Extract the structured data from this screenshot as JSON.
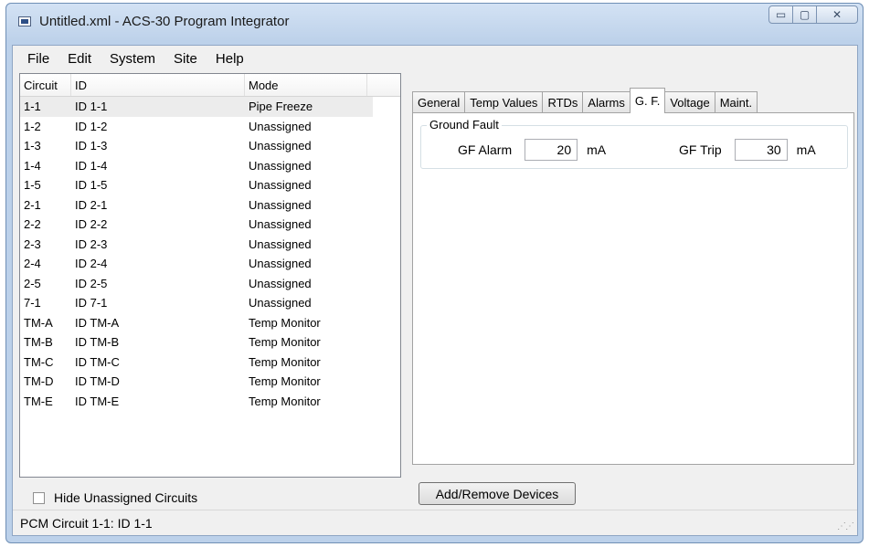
{
  "window": {
    "title": "Untitled.xml - ACS-30 Program Integrator",
    "min_glyph": "▭",
    "max_glyph": "▢",
    "close_glyph": "✕"
  },
  "menu": [
    "File",
    "Edit",
    "System",
    "Site",
    "Help"
  ],
  "circuit_list": {
    "headers": [
      "Circuit",
      "ID",
      "Mode"
    ],
    "rows": [
      [
        "1-1",
        "ID 1-1",
        "Pipe Freeze"
      ],
      [
        "1-2",
        "ID 1-2",
        "Unassigned"
      ],
      [
        "1-3",
        "ID 1-3",
        "Unassigned"
      ],
      [
        "1-4",
        "ID 1-4",
        "Unassigned"
      ],
      [
        "1-5",
        "ID 1-5",
        "Unassigned"
      ],
      [
        "2-1",
        "ID 2-1",
        "Unassigned"
      ],
      [
        "2-2",
        "ID 2-2",
        "Unassigned"
      ],
      [
        "2-3",
        "ID 2-3",
        "Unassigned"
      ],
      [
        "2-4",
        "ID 2-4",
        "Unassigned"
      ],
      [
        "2-5",
        "ID 2-5",
        "Unassigned"
      ],
      [
        "7-1",
        "ID 7-1",
        "Unassigned"
      ],
      [
        "TM-A",
        "ID TM-A",
        "Temp Monitor"
      ],
      [
        "TM-B",
        "ID TM-B",
        "Temp Monitor"
      ],
      [
        "TM-C",
        "ID TM-C",
        "Temp Monitor"
      ],
      [
        "TM-D",
        "ID TM-D",
        "Temp Monitor"
      ],
      [
        "TM-E",
        "ID TM-E",
        "Temp Monitor"
      ]
    ],
    "selected_index": 0
  },
  "hide_unassigned": {
    "label": "Hide Unassigned Circuits",
    "checked": false
  },
  "tabs": [
    "General",
    "Temp Values",
    "RTDs",
    "Alarms",
    "G. F.",
    "Voltage",
    "Maint."
  ],
  "active_tab": "G. F.",
  "ground_fault": {
    "title": "Ground Fault",
    "alarm_label": "GF Alarm",
    "alarm_value": "20",
    "alarm_unit": "mA",
    "trip_label": "GF Trip",
    "trip_value": "30",
    "trip_unit": "mA"
  },
  "add_remove_button": "Add/Remove Devices",
  "status_text": "PCM Circuit 1-1: ID 1-1"
}
